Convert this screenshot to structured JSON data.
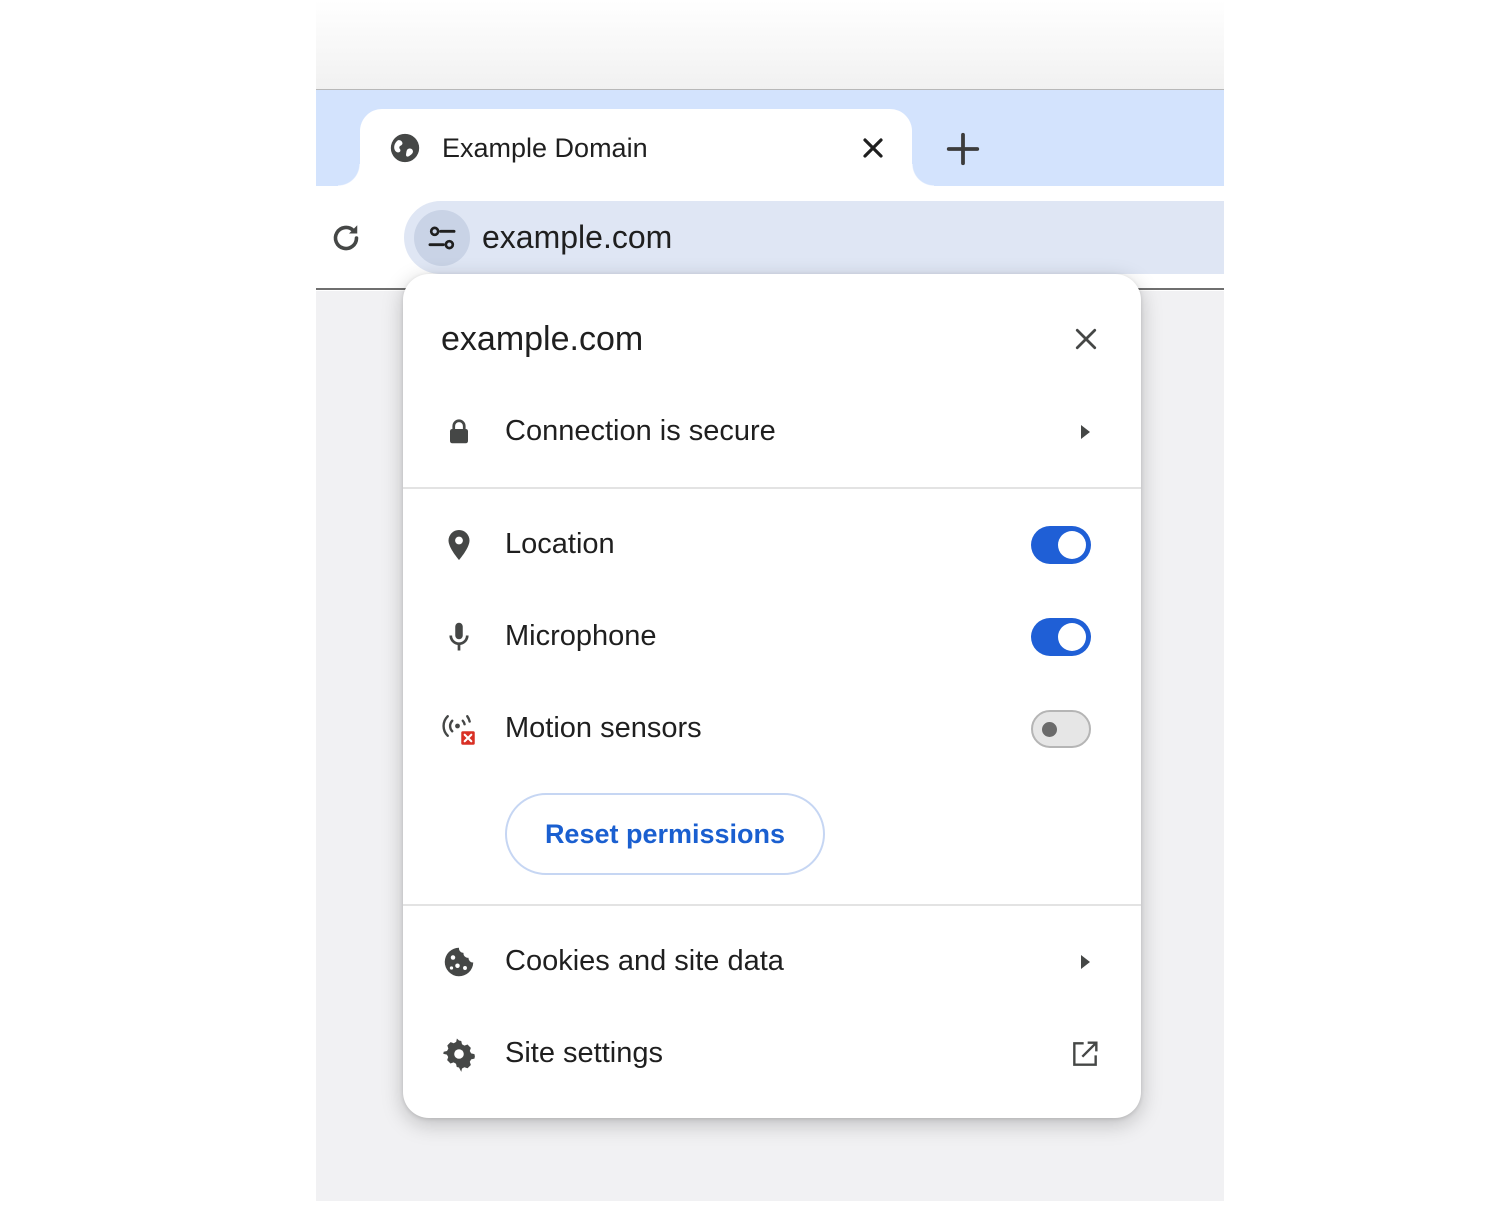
{
  "tab": {
    "title": "Example Domain",
    "favicon_icon": "globe-icon",
    "close_icon": "close-icon"
  },
  "new_tab_icon": "plus-icon",
  "toolbar": {
    "reload_icon": "reload-icon",
    "site_info_icon": "tune-icon",
    "url": "example.com"
  },
  "popup": {
    "title": "example.com",
    "close_icon": "close-icon",
    "connection": {
      "label": "Connection is secure",
      "icon": "lock-icon",
      "expand_icon": "caret-right-icon"
    },
    "permissions": [
      {
        "label": "Location",
        "icon": "location-pin-icon",
        "enabled": true
      },
      {
        "label": "Microphone",
        "icon": "microphone-icon",
        "enabled": true
      },
      {
        "label": "Motion sensors",
        "icon": "motion-sensors-blocked-icon",
        "enabled": false
      }
    ],
    "reset_button": "Reset permissions",
    "cookies": {
      "label": "Cookies and site data",
      "icon": "cookie-icon",
      "expand_icon": "caret-right-icon"
    },
    "site_settings": {
      "label": "Site settings",
      "icon": "gear-icon",
      "open_icon": "external-link-icon"
    }
  },
  "colors": {
    "tabstrip": "#d3e3fd",
    "omnibox": "#dfe6f4",
    "toggle_on": "#1f5fd6",
    "link_blue": "#1a5fd0",
    "blocked_red": "#d93025"
  }
}
